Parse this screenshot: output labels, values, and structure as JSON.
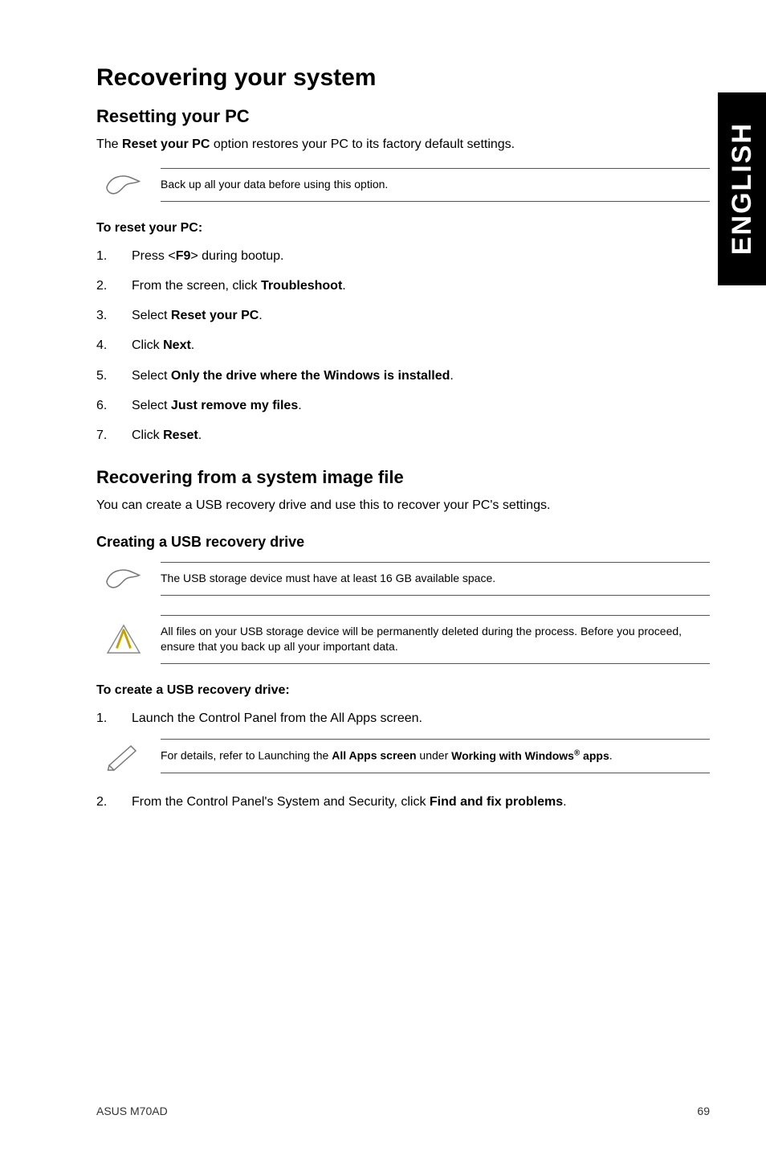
{
  "sideTab": "ENGLISH",
  "title": "Recovering your system",
  "section1": {
    "heading": "Resetting your PC",
    "intro_pre": "The ",
    "intro_bold": "Reset your PC",
    "intro_post": " option restores your PC to its factory default settings.",
    "note": "Back up all your data before using this option.",
    "stepsHeading": "To reset your PC:",
    "steps": [
      {
        "pre": "Press <",
        "b1": "F9",
        "post": "> during bootup."
      },
      {
        "pre": "From the screen, click ",
        "b1": "Troubleshoot",
        "post": "."
      },
      {
        "pre": "Select ",
        "b1": "Reset your PC",
        "post": "."
      },
      {
        "pre": "Click ",
        "b1": "Next",
        "post": "."
      },
      {
        "pre": "Select ",
        "b1": "Only the drive where the Windows is installed",
        "post": "."
      },
      {
        "pre": "Select ",
        "b1": "Just remove my files",
        "post": "."
      },
      {
        "pre": "Click ",
        "b1": "Reset",
        "post": "."
      }
    ]
  },
  "section2": {
    "heading": "Recovering from a system image file",
    "intro": "You can create a USB recovery drive and use this to recover your PC's settings.",
    "subheading": "Creating a USB recovery drive",
    "note1": "The USB storage device must have at least 16 GB available space.",
    "note2": "All files on your USB storage device will be permanently deleted during the process. Before you proceed, ensure that you back up all your important data.",
    "stepsHeading": "To create a USB recovery drive:",
    "step1": "Launch the Control Panel from the All Apps screen.",
    "note3_pre": "For details, refer to Launching the ",
    "note3_b1": "All Apps screen",
    "note3_mid": " under ",
    "note3_b2_pre": "Working with Windows",
    "note3_b2_sup": "®",
    "note3_b2_post": " apps",
    "note3_end": ".",
    "step2_pre": "From the Control Panel's System and Security, click ",
    "step2_b": "Find and fix problems",
    "step2_post": "."
  },
  "footer": {
    "left": "ASUS M70AD",
    "right": "69"
  }
}
